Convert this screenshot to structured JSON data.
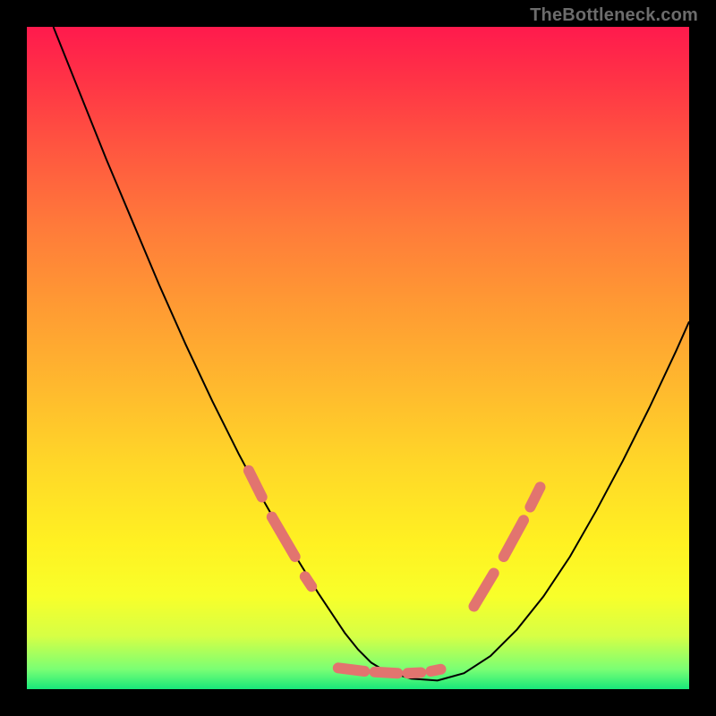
{
  "watermark": "TheBottleneck.com",
  "chart_data": {
    "type": "line",
    "title": "",
    "xlabel": "",
    "ylabel": "",
    "xlim": [
      0,
      100
    ],
    "ylim": [
      0,
      100
    ],
    "grid": false,
    "series": [
      {
        "name": "curve",
        "x": [
          4,
          8,
          12,
          16,
          20,
          24,
          28,
          32,
          36,
          40,
          44,
          48,
          50,
          52,
          54,
          58,
          62,
          66,
          70,
          74,
          78,
          82,
          86,
          90,
          94,
          98,
          100
        ],
        "y": [
          100,
          90,
          80,
          70.5,
          61,
          52,
          43.5,
          35.5,
          28,
          21,
          14.5,
          8.5,
          6,
          4,
          2.8,
          1.6,
          1.3,
          2.4,
          5.0,
          9.0,
          14.0,
          20.0,
          27.0,
          34.5,
          42.5,
          51.0,
          55.5
        ]
      }
    ],
    "markers": {
      "name": "highlight-dots",
      "color": "#e2746f",
      "segments": [
        {
          "x1": 33.5,
          "y1": 33.0,
          "x2": 35.5,
          "y2": 29.0
        },
        {
          "x1": 37.0,
          "y1": 26.0,
          "x2": 40.5,
          "y2": 20.0
        },
        {
          "x1": 42.0,
          "y1": 17.0,
          "x2": 43.0,
          "y2": 15.5
        },
        {
          "x1": 47.0,
          "y1": 3.2,
          "x2": 51.0,
          "y2": 2.7
        },
        {
          "x1": 52.5,
          "y1": 2.6,
          "x2": 56.0,
          "y2": 2.4
        },
        {
          "x1": 57.5,
          "y1": 2.4,
          "x2": 59.5,
          "y2": 2.5
        },
        {
          "x1": 61.0,
          "y1": 2.7,
          "x2": 62.5,
          "y2": 3.0
        },
        {
          "x1": 67.5,
          "y1": 12.5,
          "x2": 70.5,
          "y2": 17.5
        },
        {
          "x1": 72.0,
          "y1": 20.0,
          "x2": 75.0,
          "y2": 25.5
        },
        {
          "x1": 76.0,
          "y1": 27.5,
          "x2": 77.5,
          "y2": 30.5
        }
      ]
    }
  }
}
